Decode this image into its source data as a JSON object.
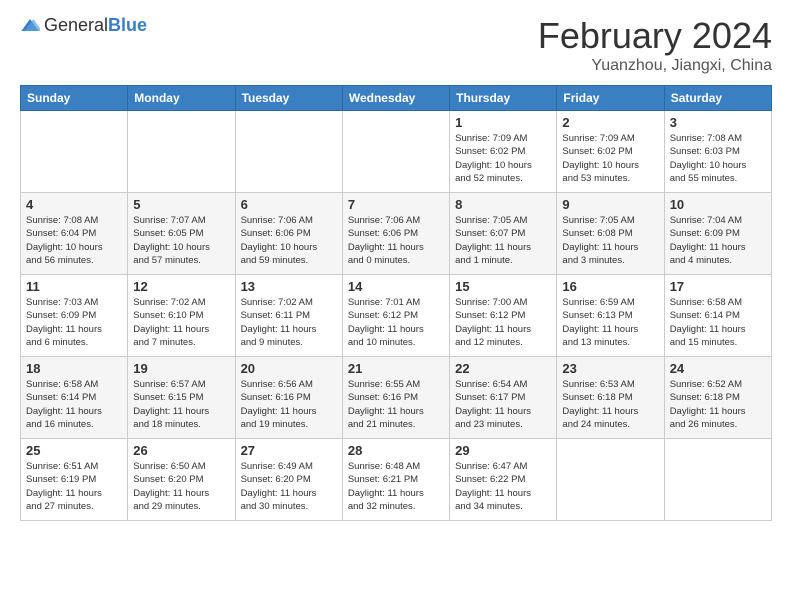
{
  "header": {
    "logo": {
      "general": "General",
      "blue": "Blue"
    },
    "title": "February 2024",
    "subtitle": "Yuanzhou, Jiangxi, China"
  },
  "calendar": {
    "headers": [
      "Sunday",
      "Monday",
      "Tuesday",
      "Wednesday",
      "Thursday",
      "Friday",
      "Saturday"
    ],
    "rows": [
      {
        "shaded": false,
        "cells": [
          {
            "day": "",
            "info": ""
          },
          {
            "day": "",
            "info": ""
          },
          {
            "day": "",
            "info": ""
          },
          {
            "day": "",
            "info": ""
          },
          {
            "day": "1",
            "info": "Sunrise: 7:09 AM\nSunset: 6:02 PM\nDaylight: 10 hours\nand 52 minutes."
          },
          {
            "day": "2",
            "info": "Sunrise: 7:09 AM\nSunset: 6:02 PM\nDaylight: 10 hours\nand 53 minutes."
          },
          {
            "day": "3",
            "info": "Sunrise: 7:08 AM\nSunset: 6:03 PM\nDaylight: 10 hours\nand 55 minutes."
          }
        ]
      },
      {
        "shaded": true,
        "cells": [
          {
            "day": "4",
            "info": "Sunrise: 7:08 AM\nSunset: 6:04 PM\nDaylight: 10 hours\nand 56 minutes."
          },
          {
            "day": "5",
            "info": "Sunrise: 7:07 AM\nSunset: 6:05 PM\nDaylight: 10 hours\nand 57 minutes."
          },
          {
            "day": "6",
            "info": "Sunrise: 7:06 AM\nSunset: 6:06 PM\nDaylight: 10 hours\nand 59 minutes."
          },
          {
            "day": "7",
            "info": "Sunrise: 7:06 AM\nSunset: 6:06 PM\nDaylight: 11 hours\nand 0 minutes."
          },
          {
            "day": "8",
            "info": "Sunrise: 7:05 AM\nSunset: 6:07 PM\nDaylight: 11 hours\nand 1 minute."
          },
          {
            "day": "9",
            "info": "Sunrise: 7:05 AM\nSunset: 6:08 PM\nDaylight: 11 hours\nand 3 minutes."
          },
          {
            "day": "10",
            "info": "Sunrise: 7:04 AM\nSunset: 6:09 PM\nDaylight: 11 hours\nand 4 minutes."
          }
        ]
      },
      {
        "shaded": false,
        "cells": [
          {
            "day": "11",
            "info": "Sunrise: 7:03 AM\nSunset: 6:09 PM\nDaylight: 11 hours\nand 6 minutes."
          },
          {
            "day": "12",
            "info": "Sunrise: 7:02 AM\nSunset: 6:10 PM\nDaylight: 11 hours\nand 7 minutes."
          },
          {
            "day": "13",
            "info": "Sunrise: 7:02 AM\nSunset: 6:11 PM\nDaylight: 11 hours\nand 9 minutes."
          },
          {
            "day": "14",
            "info": "Sunrise: 7:01 AM\nSunset: 6:12 PM\nDaylight: 11 hours\nand 10 minutes."
          },
          {
            "day": "15",
            "info": "Sunrise: 7:00 AM\nSunset: 6:12 PM\nDaylight: 11 hours\nand 12 minutes."
          },
          {
            "day": "16",
            "info": "Sunrise: 6:59 AM\nSunset: 6:13 PM\nDaylight: 11 hours\nand 13 minutes."
          },
          {
            "day": "17",
            "info": "Sunrise: 6:58 AM\nSunset: 6:14 PM\nDaylight: 11 hours\nand 15 minutes."
          }
        ]
      },
      {
        "shaded": true,
        "cells": [
          {
            "day": "18",
            "info": "Sunrise: 6:58 AM\nSunset: 6:14 PM\nDaylight: 11 hours\nand 16 minutes."
          },
          {
            "day": "19",
            "info": "Sunrise: 6:57 AM\nSunset: 6:15 PM\nDaylight: 11 hours\nand 18 minutes."
          },
          {
            "day": "20",
            "info": "Sunrise: 6:56 AM\nSunset: 6:16 PM\nDaylight: 11 hours\nand 19 minutes."
          },
          {
            "day": "21",
            "info": "Sunrise: 6:55 AM\nSunset: 6:16 PM\nDaylight: 11 hours\nand 21 minutes."
          },
          {
            "day": "22",
            "info": "Sunrise: 6:54 AM\nSunset: 6:17 PM\nDaylight: 11 hours\nand 23 minutes."
          },
          {
            "day": "23",
            "info": "Sunrise: 6:53 AM\nSunset: 6:18 PM\nDaylight: 11 hours\nand 24 minutes."
          },
          {
            "day": "24",
            "info": "Sunrise: 6:52 AM\nSunset: 6:18 PM\nDaylight: 11 hours\nand 26 minutes."
          }
        ]
      },
      {
        "shaded": false,
        "cells": [
          {
            "day": "25",
            "info": "Sunrise: 6:51 AM\nSunset: 6:19 PM\nDaylight: 11 hours\nand 27 minutes."
          },
          {
            "day": "26",
            "info": "Sunrise: 6:50 AM\nSunset: 6:20 PM\nDaylight: 11 hours\nand 29 minutes."
          },
          {
            "day": "27",
            "info": "Sunrise: 6:49 AM\nSunset: 6:20 PM\nDaylight: 11 hours\nand 30 minutes."
          },
          {
            "day": "28",
            "info": "Sunrise: 6:48 AM\nSunset: 6:21 PM\nDaylight: 11 hours\nand 32 minutes."
          },
          {
            "day": "29",
            "info": "Sunrise: 6:47 AM\nSunset: 6:22 PM\nDaylight: 11 hours\nand 34 minutes."
          },
          {
            "day": "",
            "info": ""
          },
          {
            "day": "",
            "info": ""
          }
        ]
      }
    ]
  }
}
